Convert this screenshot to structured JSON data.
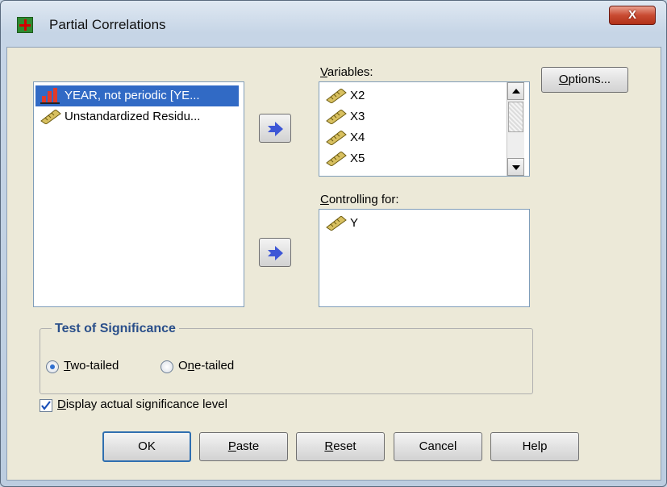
{
  "window": {
    "title": "Partial Correlations",
    "close_label": "X"
  },
  "source_list": {
    "items": [
      {
        "label": "YEAR, not periodic [YE...",
        "icon": "nominal-bars-icon",
        "selected": true
      },
      {
        "label": "Unstandardized Residu...",
        "icon": "scale-ruler-icon",
        "selected": false
      }
    ]
  },
  "variables": {
    "label": "Variables:",
    "items": [
      {
        "label": "X2",
        "icon": "scale-ruler-icon"
      },
      {
        "label": "X3",
        "icon": "scale-ruler-icon"
      },
      {
        "label": "X4",
        "icon": "scale-ruler-icon"
      },
      {
        "label": "X5",
        "icon": "scale-ruler-icon"
      }
    ]
  },
  "controlling": {
    "label": "Controlling for:",
    "items": [
      {
        "label": "Y",
        "icon": "scale-ruler-icon"
      }
    ]
  },
  "buttons": {
    "options": "Options...",
    "ok": "OK",
    "paste": "Paste",
    "reset": "Reset",
    "cancel": "Cancel",
    "help": "Help"
  },
  "test_of_significance": {
    "title": "Test of Significance",
    "two_tailed": "Two-tailed",
    "one_tailed": "One-tailed",
    "selected": "Two-tailed"
  },
  "display_actual": {
    "label": "Display actual significance level",
    "checked": true
  },
  "colors": {
    "selection": "#316ac5",
    "group_title": "#2a4f8a",
    "arrow": "#3d56d6"
  }
}
